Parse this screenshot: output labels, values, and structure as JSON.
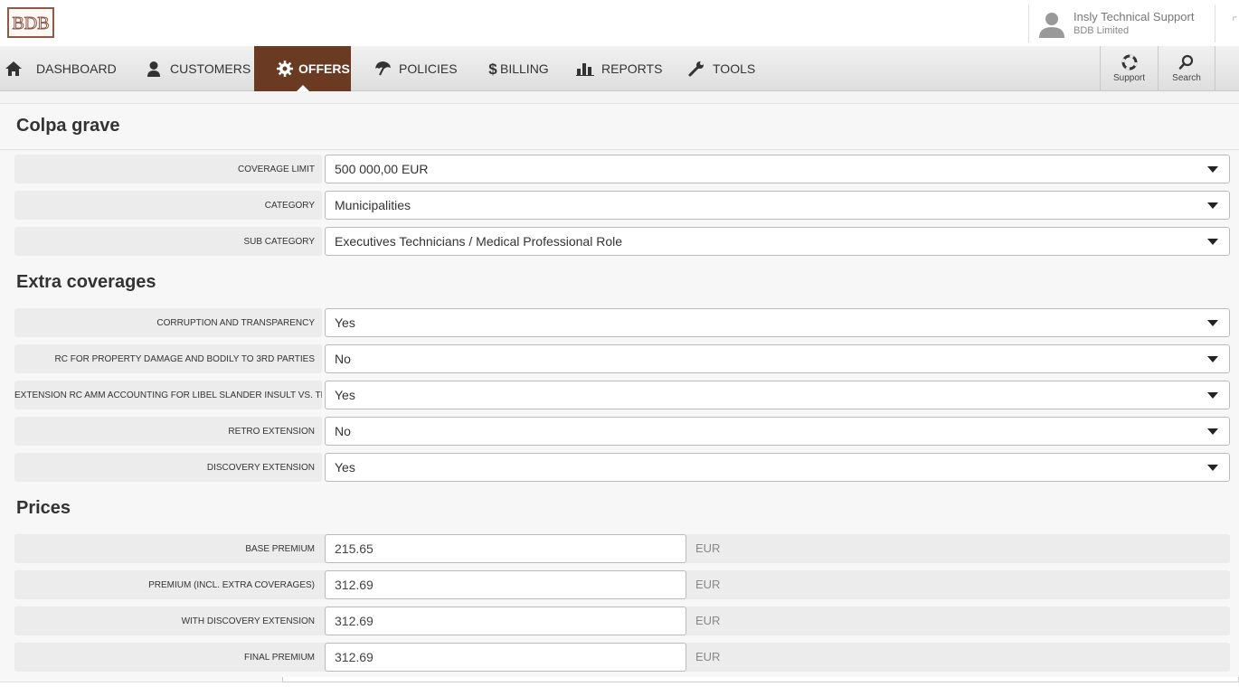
{
  "brand": {
    "logo_text": "BDB",
    "accent": "#6b3a22"
  },
  "user": {
    "name": "Insly Technical Support",
    "company": "BDB Limited"
  },
  "nav": {
    "items": [
      {
        "label": "DASHBOARD",
        "icon": "home-icon"
      },
      {
        "label": "CUSTOMERS",
        "icon": "person-icon"
      },
      {
        "label": "OFFERS",
        "icon": "gear-badge-icon",
        "active": true
      },
      {
        "label": "POLICIES",
        "icon": "umbrella-icon"
      },
      {
        "label": "BILLING",
        "icon": "dollar-icon"
      },
      {
        "label": "REPORTS",
        "icon": "bar-chart-icon"
      },
      {
        "label": "TOOLS",
        "icon": "wrench-icon"
      }
    ],
    "support_label": "Support",
    "search_label": "Search"
  },
  "sections": {
    "main_title": "Colpa grave",
    "extra_title": "Extra coverages",
    "prices_title": "Prices"
  },
  "main_fields": [
    {
      "label": "COVERAGE LIMIT",
      "value": "500 000,00 EUR"
    },
    {
      "label": "CATEGORY",
      "value": "Municipalities"
    },
    {
      "label": "SUB CATEGORY",
      "value": "Executives Technicians / Medical Professional Role"
    }
  ],
  "extra_fields": [
    {
      "label": "CORRUPTION AND TRANSPARENCY",
      "value": "Yes"
    },
    {
      "label": "RC FOR PROPERTY DAMAGE AND BODILY TO 3RD PARTIES",
      "value": "No"
    },
    {
      "label": "EXTENSION RC AMM ACCOUNTING FOR LIBEL SLANDER INSULT VS. THIR",
      "value": "Yes"
    },
    {
      "label": "RETRO EXTENSION",
      "value": "No"
    },
    {
      "label": "DISCOVERY EXTENSION",
      "value": "Yes"
    }
  ],
  "price_fields": [
    {
      "label": "BASE PREMIUM",
      "value": "215.65",
      "currency": "EUR"
    },
    {
      "label": "PREMIUM (INCL. EXTRA COVERAGES)",
      "value": "312.69",
      "currency": "EUR"
    },
    {
      "label": "WITH DISCOVERY EXTENSION",
      "value": "312.69",
      "currency": "EUR"
    },
    {
      "label": "FINAL PREMIUM",
      "value": "312.69",
      "currency": "EUR"
    }
  ]
}
